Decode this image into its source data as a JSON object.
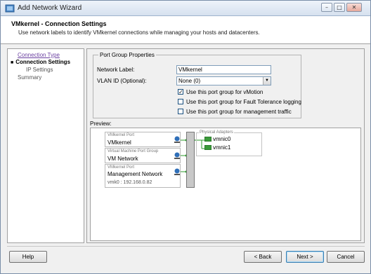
{
  "window": {
    "title": "Add Network Wizard"
  },
  "header": {
    "title": "VMkernel - Connection Settings",
    "description": "Use network labels to identify VMkernel connections while managing your hosts and datacenters."
  },
  "nav": {
    "items": [
      {
        "label": "Connection Type"
      },
      {
        "label": "Connection Settings"
      },
      {
        "label": "IP Settings"
      },
      {
        "label": "Summary"
      }
    ]
  },
  "port_group": {
    "legend": "Port Group Properties",
    "network_label_label": "Network Label:",
    "network_label_value": "VMkernel",
    "vlan_label": "VLAN ID (Optional):",
    "vlan_value": "None (0)",
    "vmotion_label": "Use this port group for vMotion",
    "vmotion_checked": true,
    "ft_label": "Use this port group for Fault Tolerance logging",
    "ft_checked": false,
    "mgmt_label": "Use this port group for management traffic",
    "mgmt_checked": false
  },
  "preview": {
    "label": "Preview:",
    "ports": [
      {
        "caption": "VMkernel Port",
        "name": "VMkernel",
        "detail": ""
      },
      {
        "caption": "Virtual Machine Port Group",
        "name": "VM Network",
        "detail": ""
      },
      {
        "caption": "VMkernel Port",
        "name": "Management Network",
        "detail": "vmk0 : 192.168.0.82"
      }
    ],
    "physical": {
      "caption": "Physical Adapters",
      "adapters": [
        "vmnic0",
        "vmnic1"
      ]
    }
  },
  "footer": {
    "help": "Help",
    "back": "< Back",
    "next": "Next >",
    "cancel": "Cancel"
  },
  "colors": {
    "link": "#6a3fa0",
    "accent": "#3c7fb1",
    "port_link": "#2e9a2e"
  },
  "icons": {
    "window_min": "minimize-icon",
    "window_max": "maximize-icon",
    "window_close": "close-icon",
    "port": "network-port-icon",
    "adapter": "physical-nic-icon"
  }
}
